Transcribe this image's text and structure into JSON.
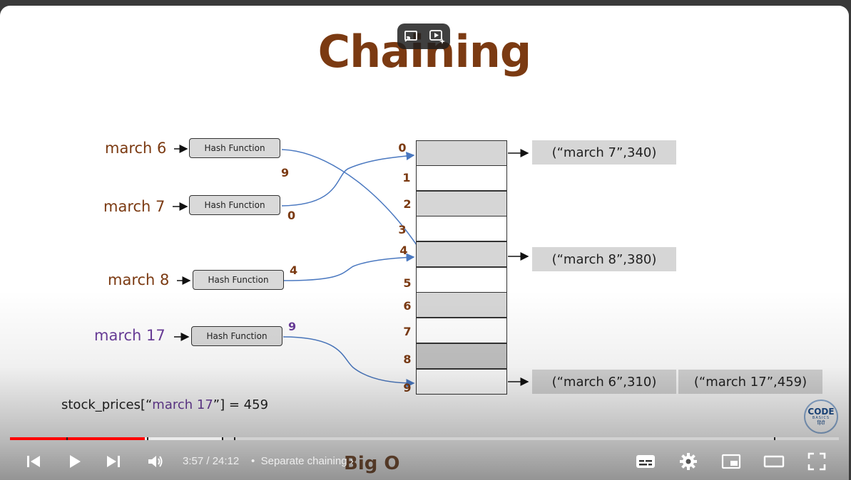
{
  "slide": {
    "title": "Chaining",
    "keys": [
      "march 6",
      "march 7",
      "march 8",
      "march 17"
    ],
    "hash_function_label": "Hash Function",
    "hash_outputs": [
      "9",
      "0",
      "4",
      "9"
    ],
    "indices": [
      "0",
      "1",
      "2",
      "3",
      "4",
      "5",
      "6",
      "7",
      "8",
      "9"
    ],
    "entries": {
      "row0": "(“march 7”,340)",
      "row4": "(“march 8”,380)",
      "row9a": "(“march 6”,310)",
      "row9b": "(“march 17”,459)"
    },
    "code": {
      "prefix": "stock_prices[“",
      "key": "march 17",
      "suffix": "”] = 459"
    },
    "logo": {
      "big": "CODE",
      "small": "BASICS",
      "hindi": "हिंदी"
    },
    "next_slide_peek": "Big O"
  },
  "player": {
    "current_time": "3:57",
    "separator": " / ",
    "duration": "24:12",
    "chapter_bullet": "•",
    "chapter_title": "Separate chaining",
    "progress_fraction": 0.163,
    "buffered_fraction": 0.256,
    "icons": [
      "previous-icon",
      "play-icon",
      "next-icon",
      "volume-icon",
      "subtitles-icon",
      "settings-icon",
      "miniplayer-icon",
      "theater-icon",
      "fullscreen-icon",
      "cast-icon",
      "autoplay-icon"
    ]
  },
  "colors": {
    "accent": "#7b3a12",
    "purple": "#6a3d9a",
    "arrow": "#4a78c0",
    "progress": "#ff0000"
  }
}
